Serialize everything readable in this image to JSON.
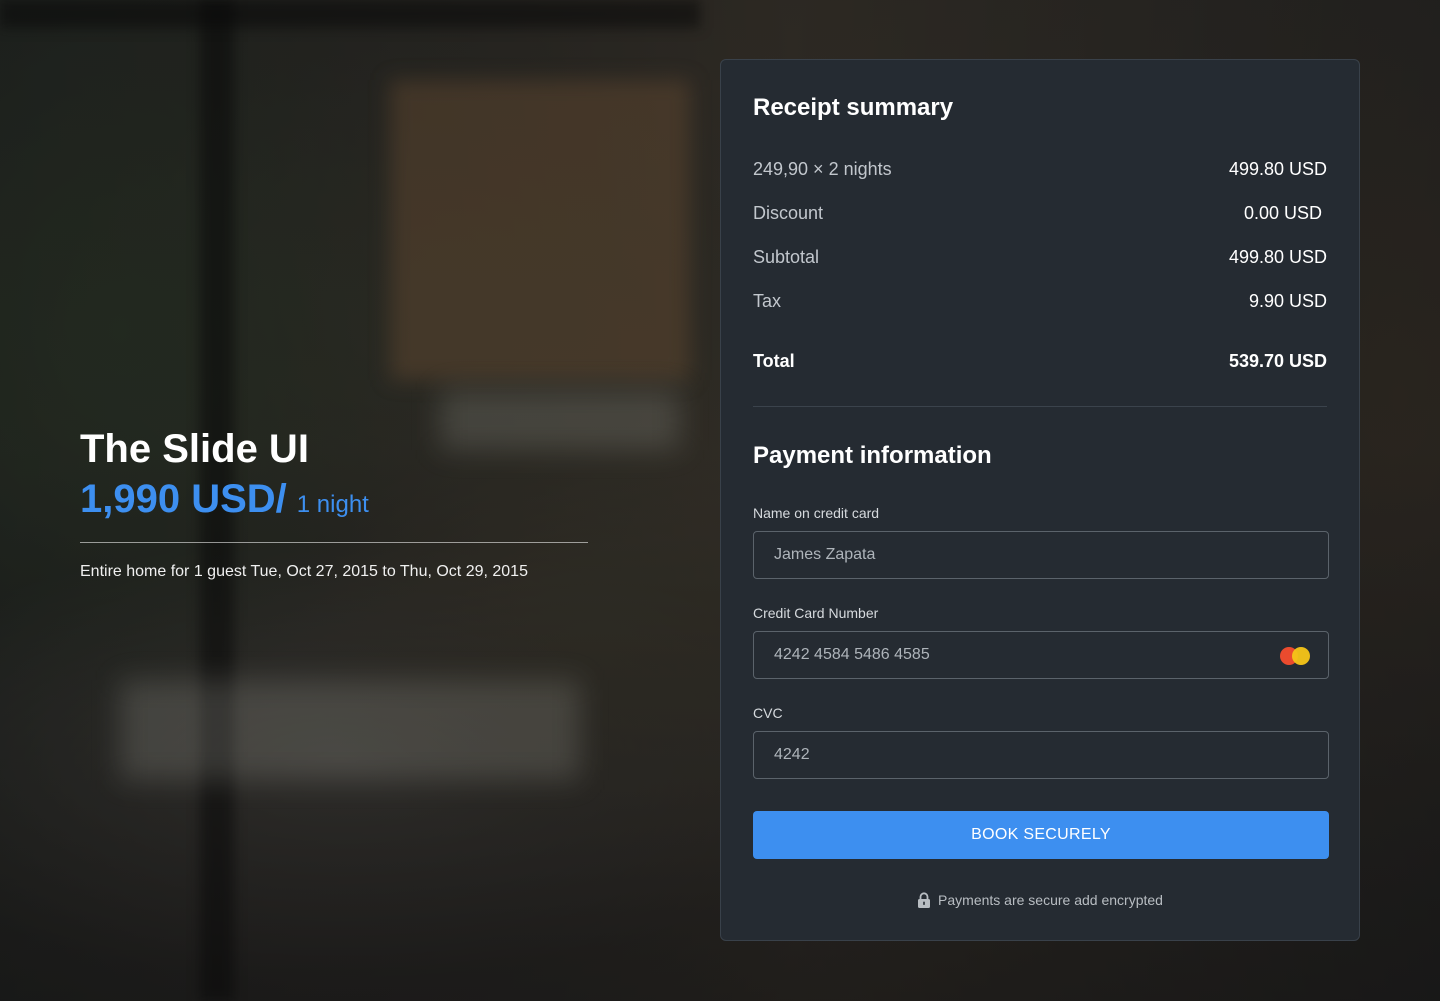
{
  "hero": {
    "title": "The Slide UI",
    "price": "1,990 USD/",
    "per": "1 night",
    "subtitle": "Entire home for 1 guest Tue, Oct 27, 2015 to Thu, Oct 29, 2015"
  },
  "receipt": {
    "heading": "Receipt summary",
    "lines": [
      {
        "label": "249,90 × 2 nights",
        "value": "499.80 USD"
      },
      {
        "label": "Discount",
        "value": "0.00 USD"
      },
      {
        "label": "Subtotal",
        "value": "499.80 USD"
      },
      {
        "label": "Tax",
        "value": "9.90 USD"
      }
    ],
    "total": {
      "label": "Total",
      "value": "539.70 USD"
    }
  },
  "payment": {
    "heading": "Payment information",
    "name_label": "Name on credit card",
    "name_value": "James Zapata",
    "card_label": "Credit Card Number",
    "card_value": "4242 4584 5486 4585",
    "card_brand_icon": "mastercard-icon",
    "cvc_label": "CVC",
    "cvc_value": "4242",
    "button_label": "BOOK SECURELY",
    "secure_note": "Payments are secure add encrypted"
  },
  "colors": {
    "accent": "#3d8ff0",
    "card_bg": "#252b32"
  }
}
